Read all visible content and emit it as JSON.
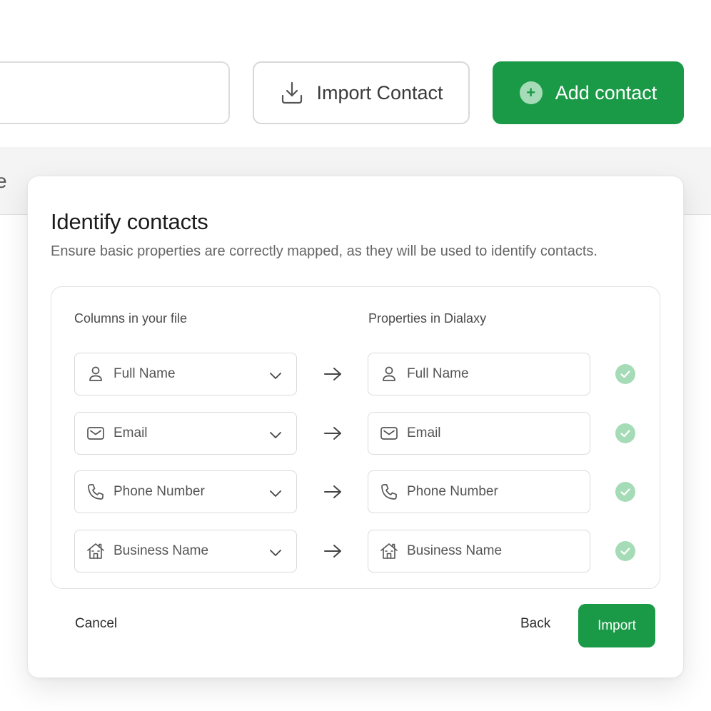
{
  "toolbar": {
    "import_contact_label": "Import Contact",
    "add_contact_label": "Add contact",
    "add_contact_glyph": "+"
  },
  "background": {
    "partial_letter": "e"
  },
  "modal": {
    "title": "Identify contacts",
    "subtitle": "Ensure basic properties are correctly mapped, as they will be used to identify contacts.",
    "columns_header": "Columns in your file",
    "properties_header": "Properties in Dialaxy",
    "rows": [
      {
        "icon": "user-icon",
        "column": "Full Name",
        "property": "Full Name",
        "status": "mapped"
      },
      {
        "icon": "mail-icon",
        "column": "Email",
        "property": "Email",
        "status": "mapped"
      },
      {
        "icon": "phone-icon",
        "column": "Phone Number",
        "property": "Phone Number",
        "status": "mapped"
      },
      {
        "icon": "business-icon",
        "column": "Business Name",
        "property": "Business Name",
        "status": "mapped"
      }
    ],
    "cancel_label": "Cancel",
    "back_label": "Back",
    "import_label": "Import"
  },
  "colors": {
    "brand_green": "#1a9a47",
    "check_green": "#a5dcb7"
  }
}
